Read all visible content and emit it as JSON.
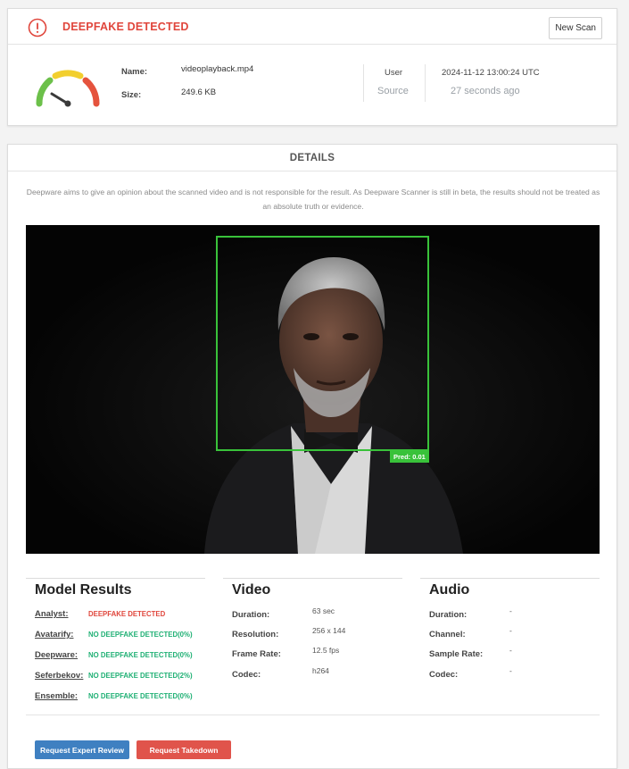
{
  "header": {
    "status_title": "DEEPFAKE DETECTED",
    "new_scan_label": "New Scan",
    "icon": "alert-circle-icon"
  },
  "file": {
    "name_label": "Name:",
    "name_value": "videoplayback.mp4",
    "size_label": "Size:",
    "size_value": "249.6 KB"
  },
  "source": {
    "user_label": "User",
    "source_label": "Source",
    "timestamp": "2024-11-12 13:00:24 UTC",
    "relative_time": "27 seconds ago"
  },
  "details": {
    "title": "DETAILS",
    "disclaimer": "Deepware aims to give an opinion about the scanned video and is not responsible for the result. As Deepware Scanner is still in beta, the results should not be treated as an absolute truth or evidence.",
    "prediction_label": "Pred: 0.01"
  },
  "model_results": {
    "title": "Model Results",
    "rows": [
      {
        "model": "Analyst:",
        "result": "DEEPFAKE DETECTED",
        "status": "bad"
      },
      {
        "model": "Avatarify:",
        "result": "NO DEEPFAKE DETECTED(0%)",
        "status": "good"
      },
      {
        "model": "Deepware:",
        "result": "NO DEEPFAKE DETECTED(0%)",
        "status": "good"
      },
      {
        "model": "Seferbekov:",
        "result": "NO DEEPFAKE DETECTED(2%)",
        "status": "good"
      },
      {
        "model": "Ensemble:",
        "result": "NO DEEPFAKE DETECTED(0%)",
        "status": "good"
      }
    ]
  },
  "video": {
    "title": "Video",
    "rows": [
      {
        "label": "Duration:",
        "value": "63 sec"
      },
      {
        "label": "Resolution:",
        "value": "256 x 144"
      },
      {
        "label": "Frame Rate:",
        "value": "12.5 fps"
      },
      {
        "label": "Codec:",
        "value": "h264"
      }
    ]
  },
  "audio": {
    "title": "Audio",
    "rows": [
      {
        "label": "Duration:",
        "value": "-"
      },
      {
        "label": "Channel:",
        "value": "-"
      },
      {
        "label": "Sample Rate:",
        "value": "-"
      },
      {
        "label": "Codec:",
        "value": "-"
      }
    ]
  },
  "actions": {
    "request_review_label": "Request Expert Review",
    "request_takedown_label": "Request Takedown"
  },
  "colors": {
    "danger": "#e0463c",
    "success": "#1fb074",
    "primary": "#3f80c1",
    "face_box": "#39c23a"
  }
}
